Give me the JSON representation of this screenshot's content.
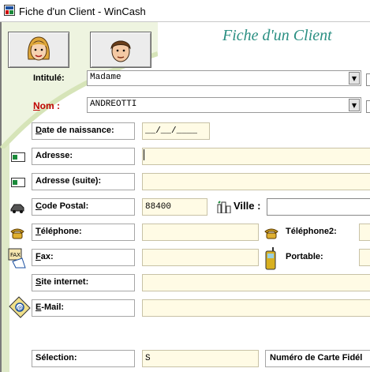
{
  "window": {
    "title": "Fiche d'un Client - WinCash"
  },
  "form": {
    "heading": "Fiche d'un Client"
  },
  "fields": {
    "intitule": {
      "label": "Intitulé:",
      "value": "Madame"
    },
    "nom": {
      "label_initial": "N",
      "label_rest": "om  :",
      "value": "ANDREOTTI"
    },
    "date_naissance": {
      "label_initial": "D",
      "label_rest": "ate de naissance:",
      "value": "__/__/____"
    },
    "adresse": {
      "label": "Adresse:",
      "value": ""
    },
    "adresse_suite": {
      "label": "Adresse (suite):",
      "value": ""
    },
    "code_postal": {
      "label_initial": "C",
      "label_rest": "ode Postal:",
      "value": "88400"
    },
    "ville": {
      "label": "Ville :",
      "value": ""
    },
    "telephone": {
      "label_initial": "T",
      "label_rest": "éléphone:",
      "value": ""
    },
    "telephone2": {
      "label": "Téléphone2:",
      "value": ""
    },
    "fax": {
      "label_initial": "F",
      "label_rest": "ax:",
      "value": ""
    },
    "portable": {
      "label": "Portable:",
      "value": ""
    },
    "site": {
      "label_initial": "S",
      "label_rest": "ite internet:",
      "value": ""
    },
    "email": {
      "label_initial": "E",
      "label_rest": "-Mail:",
      "value": ""
    },
    "selection": {
      "label": "Sélection:",
      "value": "S"
    },
    "carte": {
      "label": "Numéro de Carte Fidél"
    }
  },
  "icons": {
    "app": "wincash-app-icon",
    "photo_female": "female-face-icon",
    "photo_male": "male-face-icon",
    "adresse": "envelope-icon",
    "adresse_suite": "envelope-icon",
    "code_postal": "delivery-truck-icon",
    "ville": "city-buildings-icon",
    "telephone": "telephone-icon",
    "telephone2": "telephone-icon",
    "fax": "fax-icon",
    "portable": "mobile-phone-icon",
    "email": "email-at-icon"
  },
  "colors": {
    "accent": "#2a8f82",
    "field_bg": "#fffbe5",
    "required_label": "#c00000",
    "side_band": "#dfe9c8"
  }
}
